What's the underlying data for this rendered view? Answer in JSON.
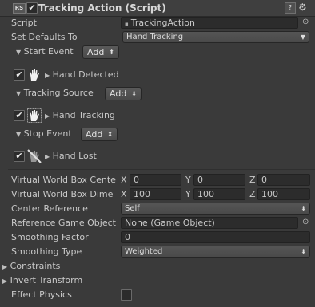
{
  "header": {
    "badge": "RS",
    "title": "Tracking Action (Script)",
    "help_icon": "?",
    "gear_icon": "⚙"
  },
  "script_row": {
    "label": "Script",
    "value": "TrackingAction"
  },
  "defaults_row": {
    "label": "Set Defaults To",
    "value": "Hand Tracking"
  },
  "start_event": {
    "label": "Start Event",
    "add": "Add"
  },
  "hand_detected": {
    "label": "Hand Detected",
    "checked": true
  },
  "tracking_source": {
    "label": "Tracking Source",
    "add": "Add"
  },
  "hand_tracking": {
    "label": "Hand Tracking",
    "checked": true
  },
  "stop_event": {
    "label": "Stop Event",
    "add": "Add"
  },
  "hand_lost": {
    "label": "Hand Lost",
    "checked": true
  },
  "box_center": {
    "label": "Virtual World Box Cente",
    "x_label": "X",
    "x": "0",
    "y_label": "Y",
    "y": "0",
    "z_label": "Z",
    "z": "0"
  },
  "box_dims": {
    "label": "Virtual World Box Dime",
    "x_label": "X",
    "x": "100",
    "y_label": "Y",
    "y": "100",
    "z_label": "Z",
    "z": "100"
  },
  "center_reference": {
    "label": "Center Reference",
    "value": "Self"
  },
  "reference_object": {
    "label": "Reference Game Object",
    "value": "None (Game Object)"
  },
  "smoothing_factor": {
    "label": "Smoothing Factor",
    "value": "0"
  },
  "smoothing_type": {
    "label": "Smoothing Type",
    "value": "Weighted"
  },
  "constraints": {
    "label": "Constraints"
  },
  "invert_transform": {
    "label": "Invert Transform"
  },
  "effect_physics": {
    "label": "Effect Physics",
    "checked": false
  },
  "colors": {
    "background": "#3a3a3a",
    "field": "#2c2c2c",
    "text": "#c9c9c9"
  }
}
